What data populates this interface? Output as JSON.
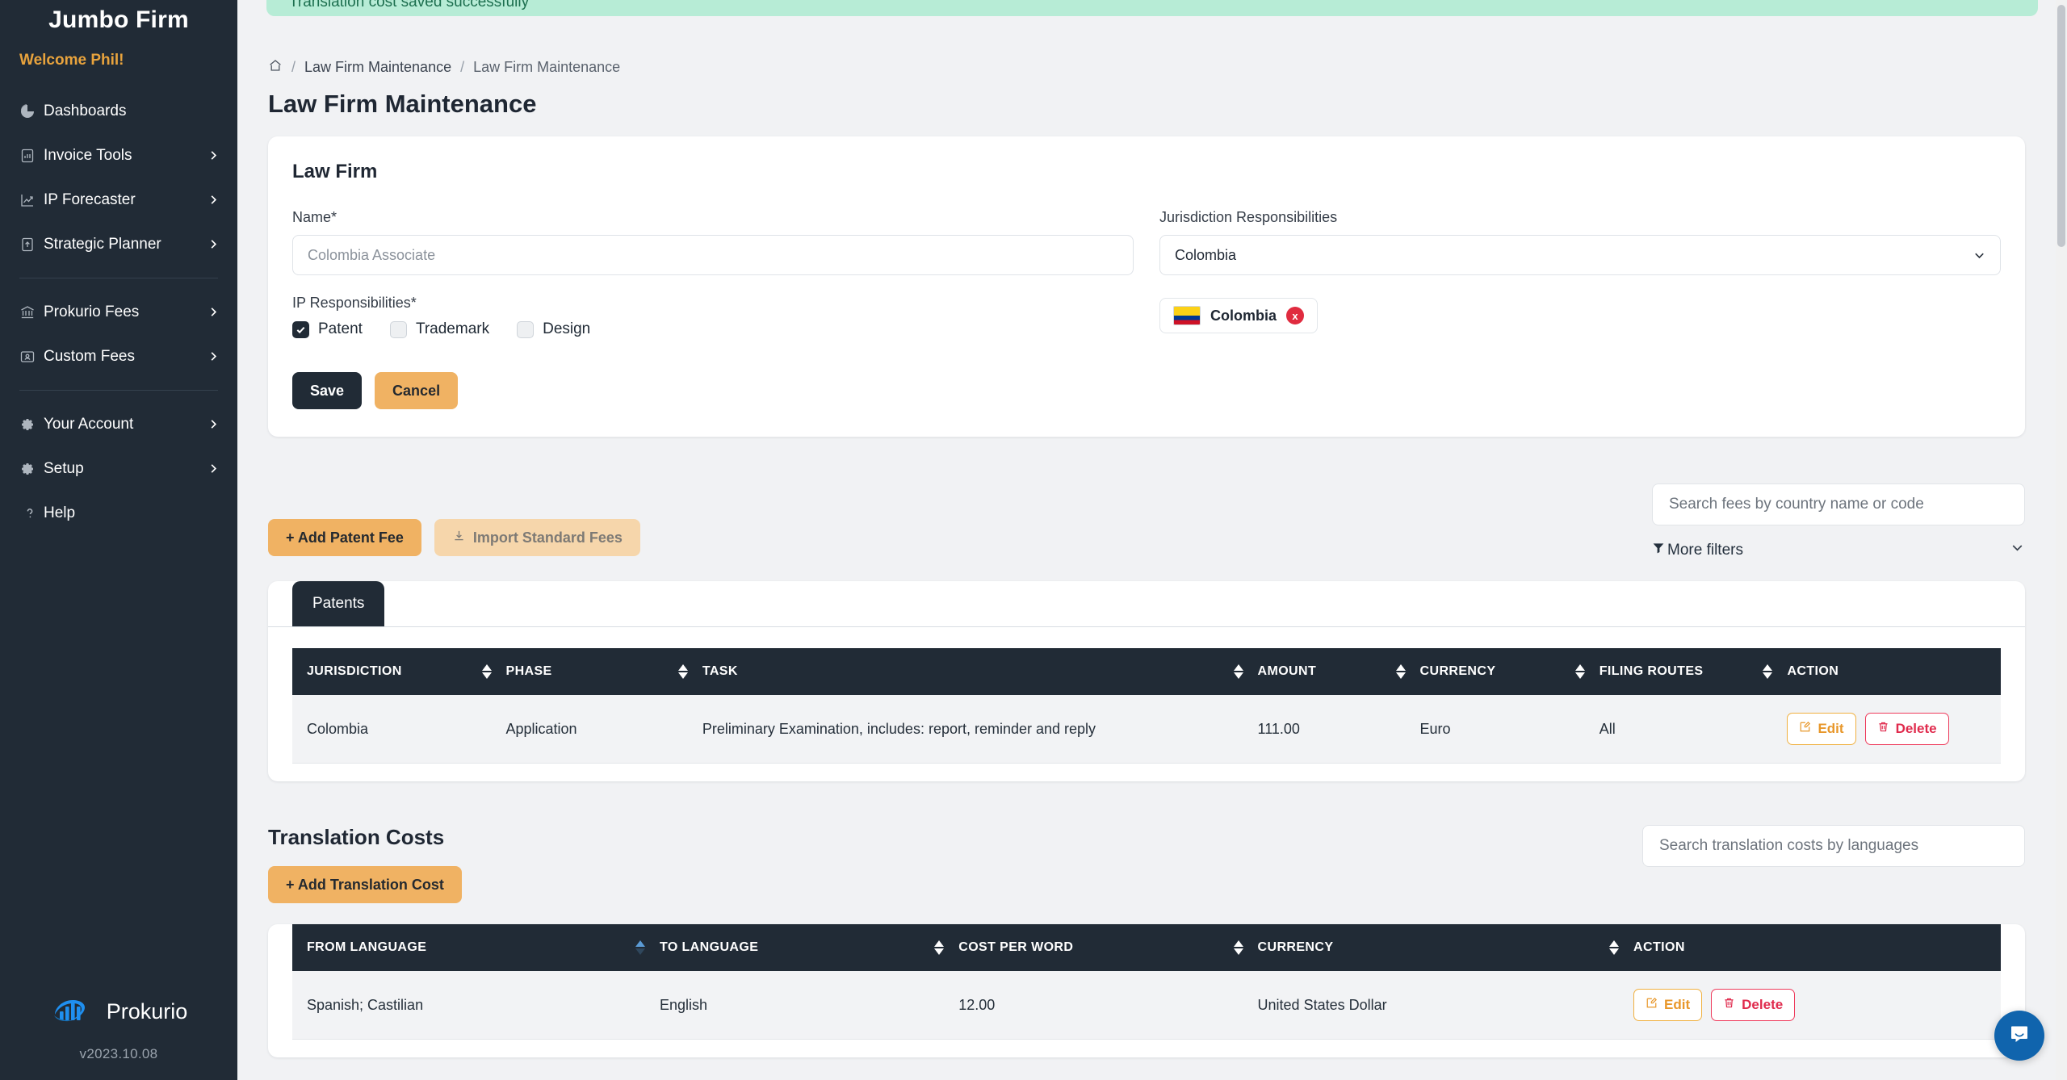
{
  "sidebar": {
    "brand": "Jumbo Firm",
    "welcome": "Welcome Phil!",
    "items": [
      {
        "label": "Dashboards",
        "icon": "pie-chart-icon",
        "chevron": false
      },
      {
        "label": "Invoice Tools",
        "icon": "clipboard-chart-icon",
        "chevron": true
      },
      {
        "label": "IP Forecaster",
        "icon": "trend-up-icon",
        "chevron": true
      },
      {
        "label": "Strategic Planner",
        "icon": "upload-doc-icon",
        "chevron": true
      }
    ],
    "items2": [
      {
        "label": "Prokurio Fees",
        "icon": "bank-icon",
        "chevron": true
      },
      {
        "label": "Custom Fees",
        "icon": "user-card-icon",
        "chevron": true
      }
    ],
    "items3": [
      {
        "label": "Your Account",
        "icon": "gear-icon",
        "chevron": true
      },
      {
        "label": "Setup",
        "icon": "gear-icon",
        "chevron": true
      },
      {
        "label": "Help",
        "icon": "question-icon",
        "chevron": false
      }
    ],
    "logo_text": "Prokurio",
    "version": "v2023.10.08"
  },
  "alert": {
    "message": "Translation cost saved successfully",
    "color": "#b7ecd6"
  },
  "breadcrumb": {
    "home_icon": "home-icon",
    "item1": "Law Firm Maintenance",
    "item2": "Law Firm Maintenance",
    "separator": "/"
  },
  "page": {
    "title": "Law Firm Maintenance"
  },
  "law_firm_card": {
    "title": "Law Firm",
    "name_label": "Name*",
    "name_placeholder": "Colombia Associate",
    "name_value": "",
    "ip_label": "IP Responsibilities*",
    "checkboxes": [
      {
        "label": "Patent",
        "checked": true
      },
      {
        "label": "Trademark",
        "checked": false
      },
      {
        "label": "Design",
        "checked": false
      }
    ],
    "save_label": "Save",
    "cancel_label": "Cancel",
    "jurisdiction_label": "Jurisdiction Responsibilities",
    "jurisdiction_value": "Colombia",
    "chip": {
      "label": "Colombia",
      "flag": "colombia-flag",
      "remove": "x"
    }
  },
  "fees_toolbar": {
    "add_patent_fee": "+ Add Patent Fee",
    "import_standard_fees": "Import Standard Fees",
    "import_icon": "download-icon",
    "search_placeholder": "Search fees by country name or code",
    "search_value": "",
    "more_filters": "More filters",
    "filter_icon": "funnel-icon",
    "chevron_icon": "chevron-down-icon"
  },
  "patents_panel": {
    "tab": "Patents",
    "columns": [
      {
        "label": "JURISDICTION",
        "sortable": true,
        "sort": "none"
      },
      {
        "label": "PHASE",
        "sortable": true,
        "sort": "none"
      },
      {
        "label": "TASK",
        "sortable": true,
        "sort": "none"
      },
      {
        "label": "AMOUNT",
        "sortable": true,
        "sort": "none"
      },
      {
        "label": "CURRENCY",
        "sortable": true,
        "sort": "none"
      },
      {
        "label": "FILING ROUTES",
        "sortable": true,
        "sort": "none"
      },
      {
        "label": "ACTION",
        "sortable": false,
        "sort": "none"
      }
    ],
    "rows": [
      {
        "jurisdiction": "Colombia",
        "phase": "Application",
        "task": "Preliminary Examination, includes: report, reminder and reply",
        "amount": "111.00",
        "currency": "Euro",
        "filing_routes": "All",
        "edit": "Edit",
        "delete": "Delete"
      }
    ]
  },
  "translation_section": {
    "title": "Translation Costs",
    "add_label": "+ Add Translation Cost",
    "search_placeholder": "Search translation costs by languages",
    "search_value": "",
    "columns": [
      {
        "label": "FROM LANGUAGE",
        "sortable": true,
        "sort": "asc"
      },
      {
        "label": "TO LANGUAGE",
        "sortable": true,
        "sort": "none"
      },
      {
        "label": "COST PER WORD",
        "sortable": true,
        "sort": "none"
      },
      {
        "label": "CURRENCY",
        "sortable": true,
        "sort": "none"
      },
      {
        "label": "ACTION",
        "sortable": false,
        "sort": "none"
      }
    ],
    "rows": [
      {
        "from_language": "Spanish; Castilian",
        "to_language": "English",
        "cost_per_word": "12.00",
        "currency": "United States Dollar",
        "edit": "Edit",
        "delete": "Delete"
      }
    ]
  },
  "intercom": {
    "icon": "chat-bubble-icon",
    "color": "#1064ad"
  }
}
